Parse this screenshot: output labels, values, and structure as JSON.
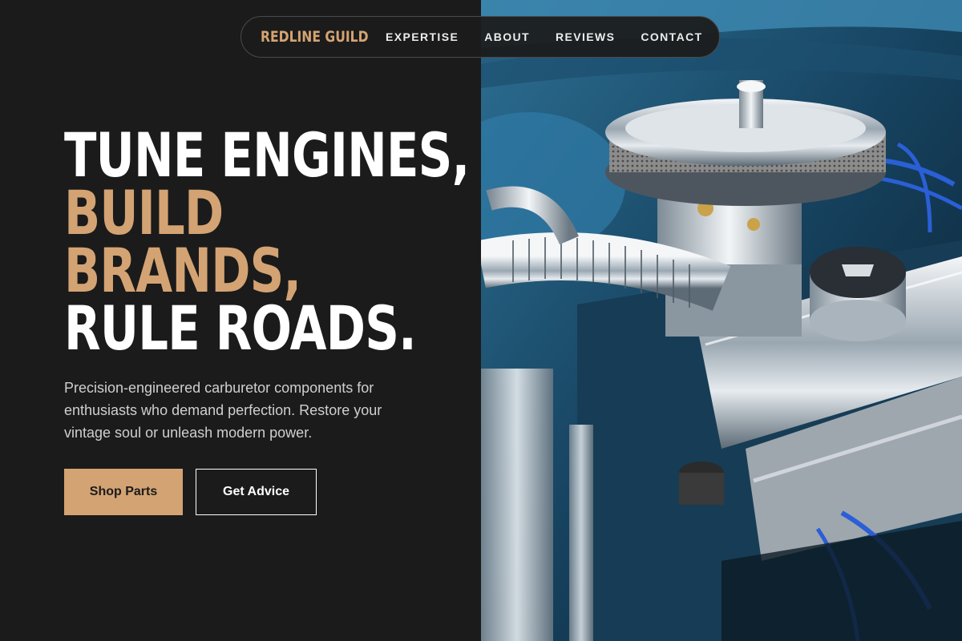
{
  "brand": {
    "name": "REDLINE GUILD"
  },
  "nav": {
    "links": [
      "EXPERTISE",
      "ABOUT",
      "REVIEWS",
      "CONTACT"
    ]
  },
  "hero": {
    "headline": {
      "line1": "TUNE ENGINES,",
      "line2": "BUILD",
      "line3": "BRANDS,",
      "line4": "RULE ROADS."
    },
    "description": "Precision-engineered carburetor components for enthusiasts who demand perfection. Restore your vintage soul or unleash modern power.",
    "primary_cta": "Shop Parts",
    "secondary_cta": "Get Advice"
  },
  "colors": {
    "background": "#1b1b1b",
    "accent": "#d4a373",
    "text": "#ffffff",
    "muted_text": "#cfcfcf"
  },
  "image": {
    "subject": "engine-photo"
  }
}
